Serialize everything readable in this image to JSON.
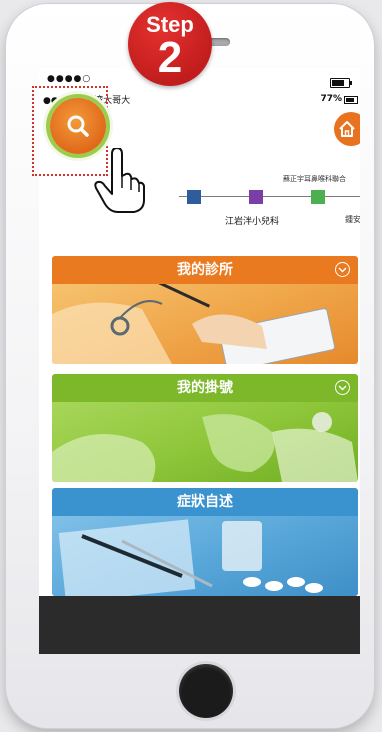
{
  "step_badge": {
    "word": "Step",
    "number": "2"
  },
  "status_bar": {
    "signal_dots": "●●●●○",
    "carrier": "●●●●○ 台湾大哥大",
    "battery_percent": "77%"
  },
  "header": {
    "profile_icon": "user-icon",
    "home_icon": "home-icon"
  },
  "search": {
    "icon": "search-icon"
  },
  "clinics": [
    {
      "label": ""
    },
    {
      "label": "江岩泮小兒科"
    },
    {
      "label": "蘇正宇耳鼻喉科聯合"
    },
    {
      "label": "鍾安"
    }
  ],
  "cards": [
    {
      "title": "我的診所",
      "color": "#ea7a1f"
    },
    {
      "title": "我的掛號",
      "color": "#7cb82a"
    },
    {
      "title": "症狀自述",
      "color": "#3a93cf"
    }
  ]
}
